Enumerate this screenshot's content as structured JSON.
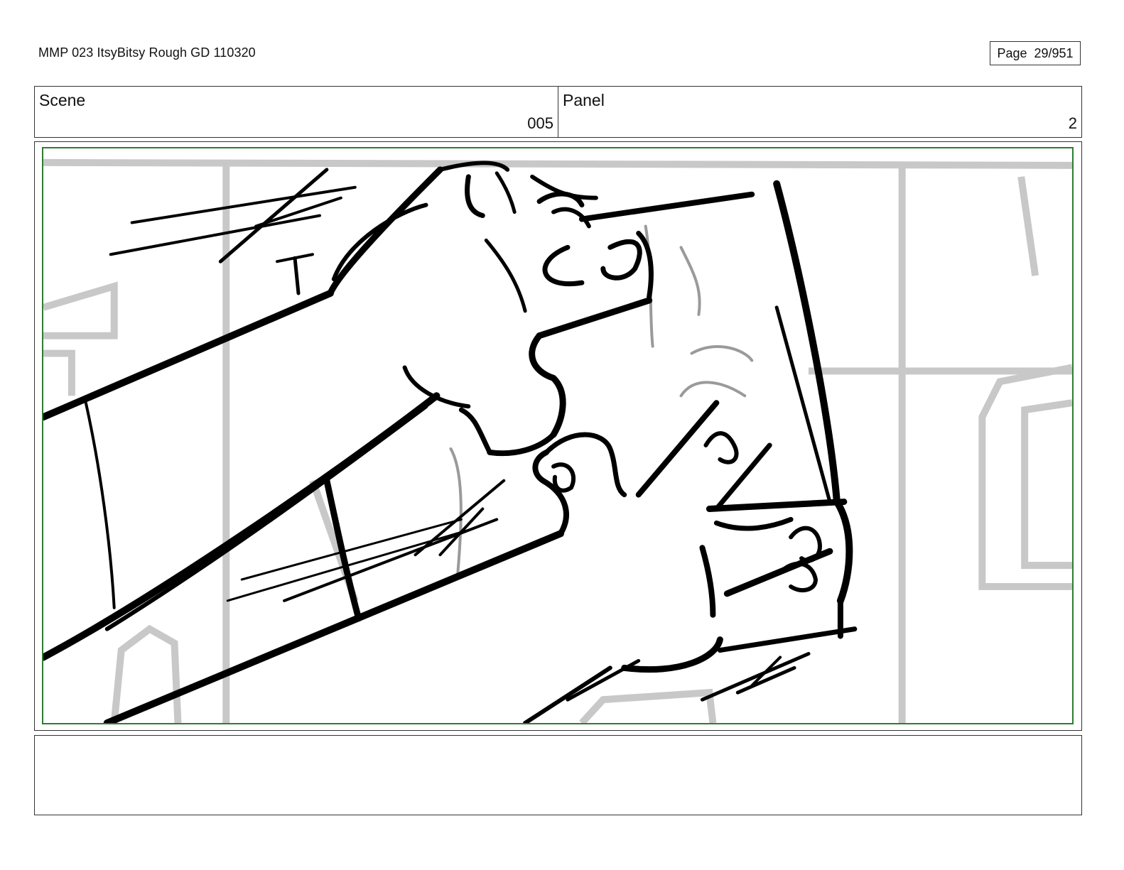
{
  "document": {
    "title": "MMP 023 ItsyBitsy Rough GD 110320",
    "page_label": "Page",
    "page_number": "29/951"
  },
  "header": {
    "scene_label": "Scene",
    "scene_value": "005",
    "panel_label": "Panel",
    "panel_value": "2"
  },
  "panel": {
    "frame_color": "#2e7d32",
    "line_color": "#000000",
    "background_line_color": "#c8c8c8"
  },
  "notes": {
    "text": ""
  }
}
